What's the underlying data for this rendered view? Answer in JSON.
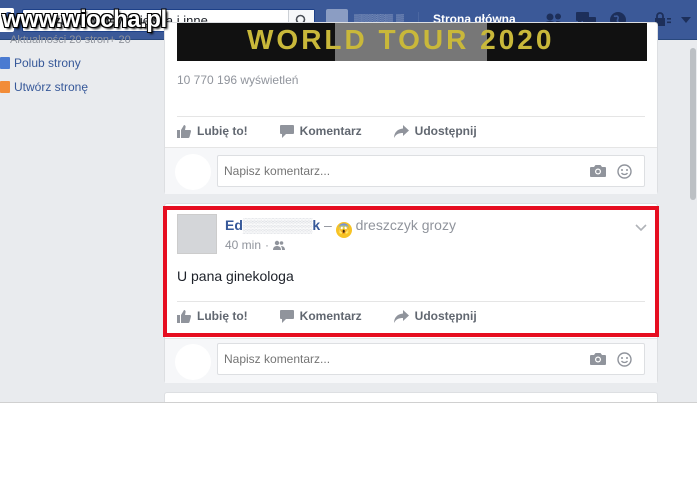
{
  "topbar": {
    "search_value": "Wyszukaj osoby, miejsca i inne",
    "home_label": "Strona główna"
  },
  "watermark": "www.wiocha.pl",
  "left_col": {
    "partial_text": "Aktualności 20 stron+ 20",
    "items": [
      {
        "label": "Polub strony",
        "icon": "like-page-icon",
        "color": "#4b7bd1"
      },
      {
        "label": "Utwórz stronę",
        "icon": "create-page-icon",
        "color": "#f28c38"
      }
    ]
  },
  "post1": {
    "video_title": "WORLD TOUR 2020",
    "views": "10 770 196 wyświetleń"
  },
  "actions": {
    "like": "Lubię to!",
    "comment": "Komentarz",
    "share": "Udostępnij"
  },
  "comment_placeholder": "Napisz komentarz...",
  "post2": {
    "author": "Ed",
    "author_tail": "k",
    "separator": "–",
    "feeling": "dreszczyk grozy",
    "time": "40 min",
    "meta_dot": "·",
    "text": "U pana ginekologa"
  },
  "colors": {
    "brand": "#3b5998",
    "highlight": "#e60d20",
    "link": "#365899"
  }
}
